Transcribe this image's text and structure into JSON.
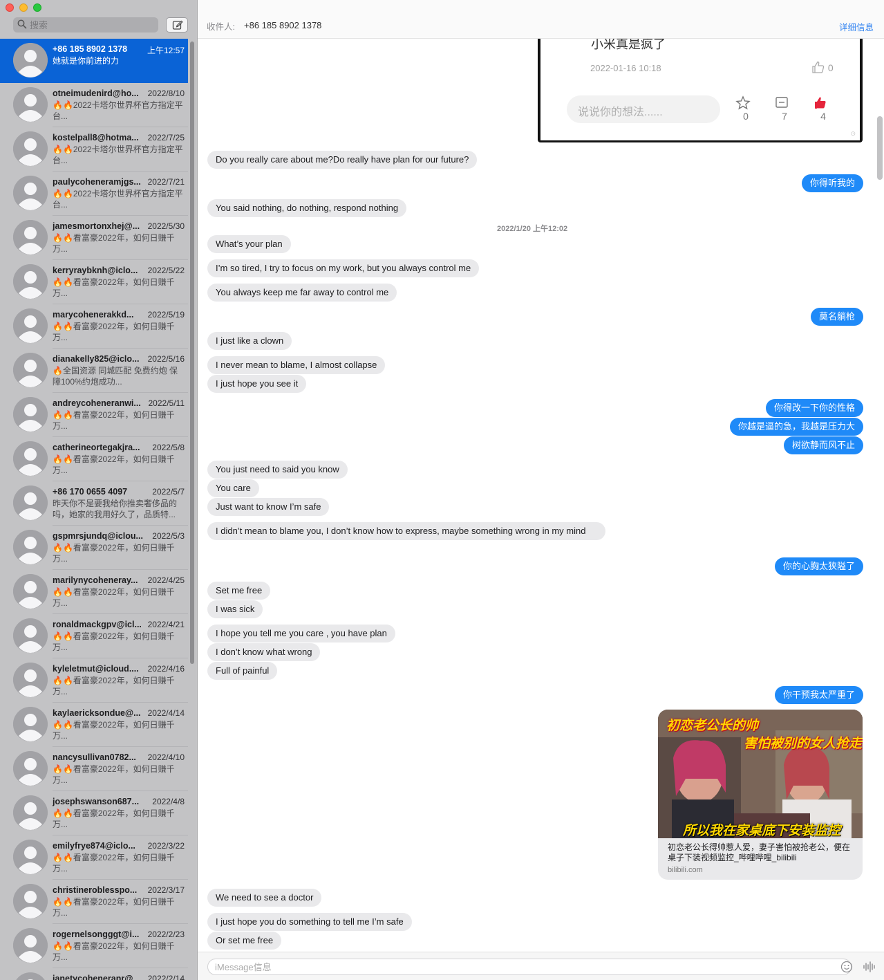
{
  "sidebar": {
    "search_placeholder": "搜索",
    "conversations": [
      {
        "name": "+86 185 8902 1378",
        "date": "上午12:57",
        "preview": "她就是你前进的力"
      },
      {
        "name": "otneimudenird@ho...",
        "date": "2022/8/10",
        "preview": "🔥🔥2022卡塔尔世界杯官方指定平台..."
      },
      {
        "name": "kostelpall8@hotma...",
        "date": "2022/7/25",
        "preview": "🔥🔥2022卡塔尔世界杯官方指定平台..."
      },
      {
        "name": "paulycoheneramjgs...",
        "date": "2022/7/21",
        "preview": "🔥🔥2022卡塔尔世界杯官方指定平台..."
      },
      {
        "name": "jamesmortonxhej@...",
        "date": "2022/5/30",
        "preview": "🔥🔥看富豪2022年，如何日赚千万..."
      },
      {
        "name": "kerryraybknh@iclo...",
        "date": "2022/5/22",
        "preview": "🔥🔥看富豪2022年，如何日赚千万..."
      },
      {
        "name": "marycohenerakkd...",
        "date": "2022/5/19",
        "preview": "🔥🔥看富豪2022年，如何日赚千万..."
      },
      {
        "name": "dianakelly825@iclo...",
        "date": "2022/5/16",
        "preview": "🔥全国资源 同城匹配 免费约炮 保障100%约炮成功..."
      },
      {
        "name": "andreycoheneranwi...",
        "date": "2022/5/11",
        "preview": "🔥🔥看富豪2022年，如何日赚千万..."
      },
      {
        "name": "catherineortegakjra...",
        "date": "2022/5/8",
        "preview": "🔥🔥看富豪2022年，如何日赚千万..."
      },
      {
        "name": "+86 170 0655 4097",
        "date": "2022/5/7",
        "preview": "昨天你不是要我给你推卖奢侈品的吗，她家的我用好久了，品质特..."
      },
      {
        "name": "gspmrsjundq@iclou...",
        "date": "2022/5/3",
        "preview": "🔥🔥看富豪2022年，如何日赚千万..."
      },
      {
        "name": "marilynycoheneray...",
        "date": "2022/4/25",
        "preview": "🔥🔥看富豪2022年，如何日赚千万..."
      },
      {
        "name": "ronaldmackgpv@icl...",
        "date": "2022/4/21",
        "preview": "🔥🔥看富豪2022年，如何日赚千万..."
      },
      {
        "name": "kyleletmut@icloud....",
        "date": "2022/4/16",
        "preview": "🔥🔥看富豪2022年，如何日赚千万..."
      },
      {
        "name": "kaylaericksondue@...",
        "date": "2022/4/14",
        "preview": "🔥🔥看富豪2022年，如何日赚千万..."
      },
      {
        "name": "nancysullivan0782...",
        "date": "2022/4/10",
        "preview": "🔥🔥看富豪2022年，如何日赚千万..."
      },
      {
        "name": "josephswanson687...",
        "date": "2022/4/8",
        "preview": "🔥🔥看富豪2022年，如何日赚千万..."
      },
      {
        "name": "emilyfrye874@iclo...",
        "date": "2022/3/22",
        "preview": "🔥🔥看富豪2022年，如何日赚千万..."
      },
      {
        "name": "christineroblesspo...",
        "date": "2022/3/17",
        "preview": "🔥🔥看富豪2022年，如何日赚千万..."
      },
      {
        "name": "rogernelsongggt@i...",
        "date": "2022/2/23",
        "preview": "🔥🔥看富豪2022年，如何日赚千万..."
      },
      {
        "name": "janetycoheneranr@...",
        "date": "2022/2/14",
        "preview": ""
      }
    ]
  },
  "header": {
    "to_label": "收件人:",
    "to_value": "+86 185 8902 1378",
    "details": "详细信息"
  },
  "attachment_screenshot": {
    "comment": "小米真是疯了",
    "date": "2022-01-16 10:18",
    "like_count": "0",
    "input_placeholder": "说说你的想法......",
    "actions": [
      {
        "icon": "star-icon",
        "count": "0"
      },
      {
        "icon": "comment-icon",
        "count": "7"
      },
      {
        "icon": "thumbs-up-icon",
        "count": "4"
      }
    ]
  },
  "messages": [
    {
      "dir": "in",
      "text": "Do you really care about me?Do really have plan for our future?"
    },
    {
      "dir": "out",
      "text": "你得听我的"
    },
    {
      "dir": "in",
      "text": "You said nothing, do nothing, respond nothing"
    },
    {
      "dir": "time",
      "text": "2022/1/20 上午12:02"
    },
    {
      "dir": "in",
      "text": "What’s your plan"
    },
    {
      "dir": "in",
      "text": "I’m so tired, I try to focus on my work, but you always control me"
    },
    {
      "dir": "in",
      "text": "You always keep me far away to control me"
    },
    {
      "dir": "out",
      "text": "莫名躺枪"
    },
    {
      "dir": "in",
      "text": "I just like a clown"
    },
    {
      "dir": "in",
      "text": "I never mean to blame, I almost collapse"
    },
    {
      "dir": "in",
      "text": "I just hope you see it"
    },
    {
      "dir": "out",
      "text": "你得改一下你的性格"
    },
    {
      "dir": "out",
      "text": "你越是逼的急，我越是压力大"
    },
    {
      "dir": "out",
      "text": "树欲静而风不止"
    },
    {
      "dir": "in",
      "text": "You just need to said you know"
    },
    {
      "dir": "in",
      "text": "You care"
    },
    {
      "dir": "in",
      "text": "Just want to know I’m safe"
    },
    {
      "dir": "in",
      "text": "I didn’t mean to blame you, I don’t know how to express, maybe something wrong in my mind"
    },
    {
      "dir": "out",
      "text": "你的心胸太狭隘了"
    },
    {
      "dir": "in",
      "text": "Set me free"
    },
    {
      "dir": "in",
      "text": "I was sick"
    },
    {
      "dir": "in",
      "text": "I hope you tell me you care , you have plan"
    },
    {
      "dir": "in",
      "text": "I don’t know what wrong"
    },
    {
      "dir": "in",
      "text": "Full of painful"
    },
    {
      "dir": "out",
      "text": "你干预我太严重了"
    },
    {
      "dir": "in",
      "text": "We need to see a doctor"
    },
    {
      "dir": "in",
      "text": "I just hope you do something to tell me I’m safe"
    },
    {
      "dir": "in",
      "text": "Or set me free"
    }
  ],
  "link_preview": {
    "overlay_line1": "初恋老公长的帅",
    "overlay_line2": "害怕被别的女人抢走",
    "overlay_line3": "所以我在家桌底下安装监控",
    "title": "初恋老公长得帅惹人爱，妻子害怕被抢老公，便在桌子下装视频监控_哔哩哔哩_bilibili",
    "domain": "bilibili.com"
  },
  "composer": {
    "placeholder": "iMessage信息"
  },
  "colors": {
    "accent": "#0a63d6",
    "bubble_out": "#1f8af8",
    "bubble_in": "#e9e9eb"
  }
}
